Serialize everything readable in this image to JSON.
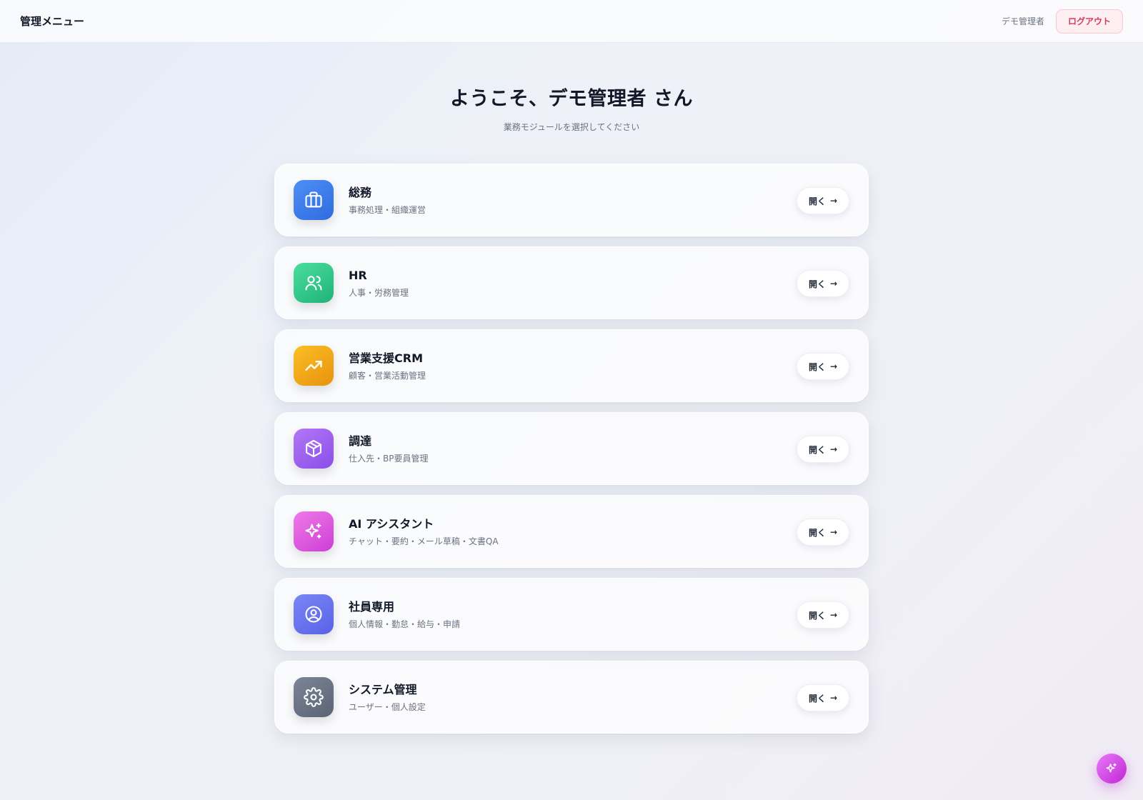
{
  "header": {
    "title": "管理メニュー",
    "user_name": "デモ管理者",
    "logout_label": "ログアウト"
  },
  "hero": {
    "welcome": "ようこそ、デモ管理者 さん",
    "subtitle": "業務モジュールを選択してください"
  },
  "modules": [
    {
      "title": "総務",
      "desc": "事務処理・組織運営",
      "icon": "briefcase-icon",
      "color_from": "#4f8df5",
      "color_to": "#2f6de0",
      "open_label": "開く",
      "arrow": "→"
    },
    {
      "title": "HR",
      "desc": "人事・労務管理",
      "icon": "users-icon",
      "color_from": "#4ade9c",
      "color_to": "#20b37a",
      "open_label": "開く",
      "arrow": "→"
    },
    {
      "title": "営業支援CRM",
      "desc": "顧客・営業活動管理",
      "icon": "trending-up-icon",
      "color_from": "#fbbf24",
      "color_to": "#e8920e",
      "open_label": "開く",
      "arrow": "→"
    },
    {
      "title": "調達",
      "desc": "仕入先・BP要員管理",
      "icon": "package-icon",
      "color_from": "#b277f5",
      "color_to": "#8b4eea",
      "open_label": "開く",
      "arrow": "→"
    },
    {
      "title": "AI アシスタント",
      "desc": "チャット・要約・メール草稿・文書QA",
      "icon": "sparkles-icon",
      "color_from": "#f07ae8",
      "color_to": "#cc3fd6",
      "open_label": "開く",
      "arrow": "→"
    },
    {
      "title": "社員専用",
      "desc": "個人情報・勤怠・給与・申請",
      "icon": "user-circle-icon",
      "color_from": "#7a86f5",
      "color_to": "#5a62e6",
      "open_label": "開く",
      "arrow": "→"
    },
    {
      "title": "システム管理",
      "desc": "ユーザー・個人設定",
      "icon": "gear-icon",
      "color_from": "#7b8597",
      "color_to": "#5b6474",
      "open_label": "開く",
      "arrow": "→"
    }
  ]
}
